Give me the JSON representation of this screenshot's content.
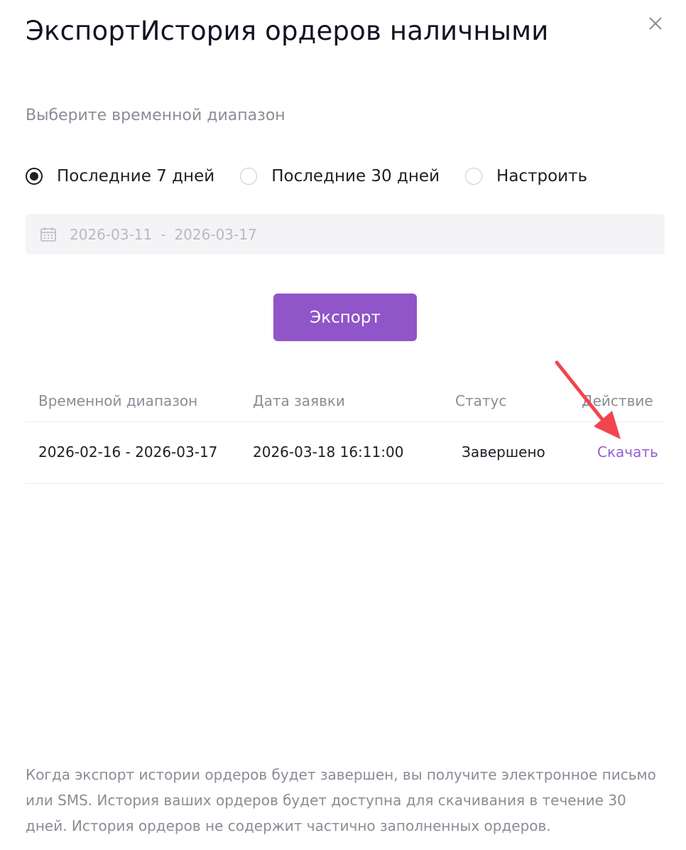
{
  "modal": {
    "title": "ЭкспортИстория ордеров наличными",
    "close_icon": "close-icon"
  },
  "range_section": {
    "label": "Выберите временной диапазон",
    "options": [
      {
        "label": "Последние 7 дней",
        "checked": true
      },
      {
        "label": "Последние 30 дней",
        "checked": false
      },
      {
        "label": "Настроить",
        "checked": false
      }
    ],
    "date_start": "2026-03-11",
    "date_separator": "-",
    "date_end": "2026-03-17",
    "calendar_icon": "calendar-icon"
  },
  "export_button": {
    "label": "Экспорт",
    "color": "#9055c8"
  },
  "history_table": {
    "columns": [
      "Временной диапазон",
      "Дата заявки",
      "Статус",
      "Действие"
    ],
    "rows": [
      {
        "range": "2026-02-16 - 2026-03-17",
        "request_date": "2026-03-18 16:11:00",
        "status": "Завершено",
        "action": "Скачать"
      }
    ]
  },
  "annotation": {
    "arrow_color": "#f2444f",
    "icon": "red-arrow-icon"
  },
  "footnote": "Когда экспорт истории ордеров будет завершен, вы получите электронное письмо или SMS. История ваших ордеров будет доступна для скачивания в течение 30 дней. История ордеров не содержит частично заполненных ордеров."
}
